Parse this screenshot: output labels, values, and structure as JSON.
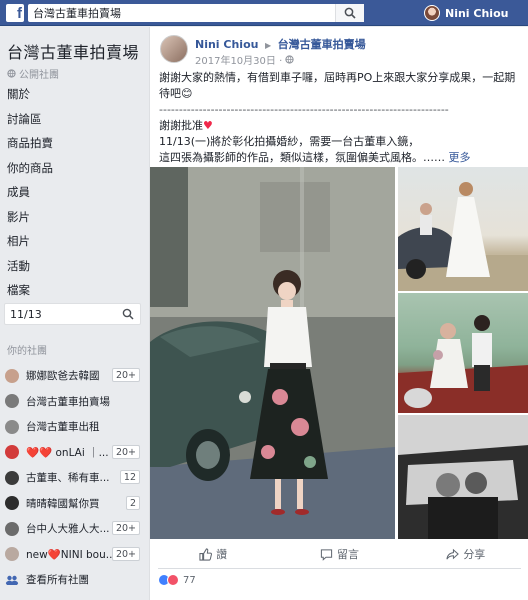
{
  "topbar": {
    "logo": "f",
    "search_value": "台灣古董車拍賣場",
    "user_name": "Nini Chiou"
  },
  "sidebar": {
    "group_title": "台灣古董車拍賣場",
    "group_type": "公開社團",
    "nav": [
      "關於",
      "討論區",
      "商品拍賣",
      "你的商品",
      "成員",
      "影片",
      "相片",
      "活動",
      "檔案"
    ],
    "search_value": "11/13",
    "your_groups_label": "你的社團",
    "groups": [
      {
        "label": "娜娜歐爸去韓國",
        "badge": "20+",
        "color": "#c7a08c"
      },
      {
        "label": "台灣古董車拍賣場",
        "badge": "",
        "color": "#7a7a7a"
      },
      {
        "label": "台灣古董車出租",
        "badge": "",
        "color": "#8a8a8a"
      },
      {
        "label": "❤️❤️ onLAi ｜...",
        "badge": "20+",
        "color": "#d23b3b"
      },
      {
        "label": "古董車、稀有車...",
        "badge": "12",
        "color": "#3b3b3b"
      },
      {
        "label": "晴晴韓國幫你買",
        "badge": "2",
        "color": "#2d2d2d"
      },
      {
        "label": "台中人大雅人大...",
        "badge": "20+",
        "color": "#6b6b6b"
      },
      {
        "label": "new❤️NINI bou...",
        "badge": "20+",
        "color": "#b9a9a0"
      }
    ],
    "see_all": "查看所有社團"
  },
  "post": {
    "author": "Nini Chiou",
    "group": "台灣古董車拍賣場",
    "date": "2017年10月30日 ·",
    "line1": "謝謝大家的熱情，有借到車子囉，屆時再PO上來跟大家分享成果，一起期待吧😊",
    "separator": "-------------------------------------------------------------------------",
    "line2": "謝謝批准",
    "line3": "11/13(一)將於彰化拍攝婚紗，需要一台古董車入鏡，",
    "line4": "這四張為攝影師的作品，類似這樣，氛圍偏美式風格。……",
    "more": "更多",
    "actions": {
      "like": "讚",
      "comment": "留言",
      "share": "分享"
    },
    "reaction_count": "77"
  },
  "colors": {
    "brand": "#3b5998",
    "link": "#365899",
    "love": "#f25268",
    "like": "#4080ff"
  }
}
